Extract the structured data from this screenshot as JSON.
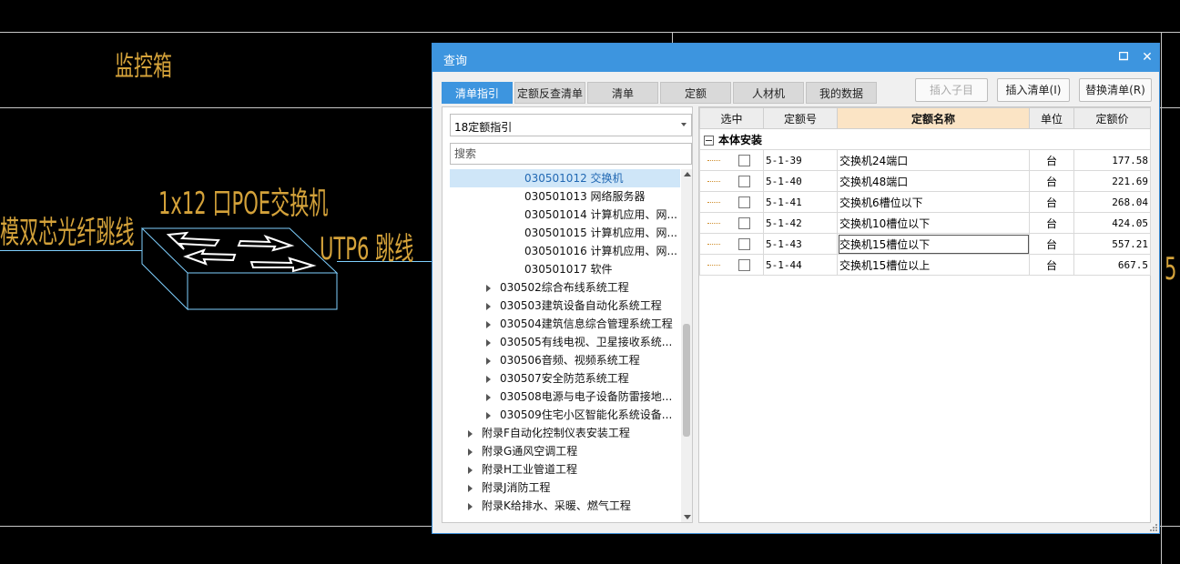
{
  "cad": {
    "label_monitor_box": "监控箱",
    "label_switch": "1x12 口POE交换机",
    "label_fiber": "模双芯光纤跳线",
    "label_utp": "UTP6 跳线",
    "label_edge": "5",
    "line_color": "#d4a23a",
    "shape_color": "#8fd8ff"
  },
  "dialog": {
    "title": "查询",
    "maximize_glyph": "□",
    "close_glyph": "✕",
    "tabs": [
      {
        "label": "清单指引",
        "active": true
      },
      {
        "label": "定额反查清单",
        "active": false
      },
      {
        "label": "清单",
        "active": false
      },
      {
        "label": "定额",
        "active": false
      },
      {
        "label": "人材机",
        "active": false
      },
      {
        "label": "我的数据",
        "active": false
      }
    ],
    "actions": {
      "insert_child": "插入子目",
      "insert_list": "插入清单(I)",
      "replace_list": "替换清单(R)"
    },
    "accent": "#3d95df"
  },
  "left": {
    "select_value": "18定额指引",
    "search_placeholder": "搜索",
    "tree": [
      {
        "text": "030501012  交换机",
        "level": 2,
        "expandable": false,
        "selected": true
      },
      {
        "text": "030501013  网络服务器",
        "level": 2,
        "expandable": false,
        "selected": false
      },
      {
        "text": "030501014  计算机应用、网...",
        "level": 2,
        "expandable": false,
        "selected": false
      },
      {
        "text": "030501015  计算机应用、网...",
        "level": 2,
        "expandable": false,
        "selected": false
      },
      {
        "text": "030501016  计算机应用、网...",
        "level": 2,
        "expandable": false,
        "selected": false
      },
      {
        "text": "030501017  软件",
        "level": 2,
        "expandable": false,
        "selected": false
      },
      {
        "text": "030502综合布线系统工程",
        "level": 1,
        "expandable": true,
        "selected": false
      },
      {
        "text": "030503建筑设备自动化系统工程",
        "level": 1,
        "expandable": true,
        "selected": false
      },
      {
        "text": "030504建筑信息综合管理系统工程",
        "level": 1,
        "expandable": true,
        "selected": false
      },
      {
        "text": "030505有线电视、卫星接收系统...",
        "level": 1,
        "expandable": true,
        "selected": false
      },
      {
        "text": "030506音频、视频系统工程",
        "level": 1,
        "expandable": true,
        "selected": false
      },
      {
        "text": "030507安全防范系统工程",
        "level": 1,
        "expandable": true,
        "selected": false
      },
      {
        "text": "030508电源与电子设备防雷接地...",
        "level": 1,
        "expandable": true,
        "selected": false
      },
      {
        "text": "030509住宅小区智能化系统设备...",
        "level": 1,
        "expandable": true,
        "selected": false
      },
      {
        "text": "附录F自动化控制仪表安装工程",
        "level": 0,
        "expandable": true,
        "selected": false
      },
      {
        "text": "附录G通风空调工程",
        "level": 0,
        "expandable": true,
        "selected": false
      },
      {
        "text": "附录H工业管道工程",
        "level": 0,
        "expandable": true,
        "selected": false
      },
      {
        "text": "附录J消防工程",
        "level": 0,
        "expandable": true,
        "selected": false
      },
      {
        "text": "附录K给排水、采暖、燃气工程",
        "level": 0,
        "expandable": true,
        "selected": false
      }
    ]
  },
  "grid": {
    "headers": [
      "选中",
      "定额号",
      "定额名称",
      "单位",
      "定额价"
    ],
    "group": "本体安装",
    "rows": [
      {
        "code": "5-1-39",
        "name": "交换机24端口",
        "unit": "台",
        "price": "177.58"
      },
      {
        "code": "5-1-40",
        "name": "交换机48端口",
        "unit": "台",
        "price": "221.69"
      },
      {
        "code": "5-1-41",
        "name": "交换机6槽位以下",
        "unit": "台",
        "price": "268.04"
      },
      {
        "code": "5-1-42",
        "name": "交换机10槽位以下",
        "unit": "台",
        "price": "424.05"
      },
      {
        "code": "5-1-43",
        "name": "交换机15槽位以下",
        "unit": "台",
        "price": "557.21"
      },
      {
        "code": "5-1-44",
        "name": "交换机15槽位以上",
        "unit": "台",
        "price": "667.5"
      }
    ]
  }
}
